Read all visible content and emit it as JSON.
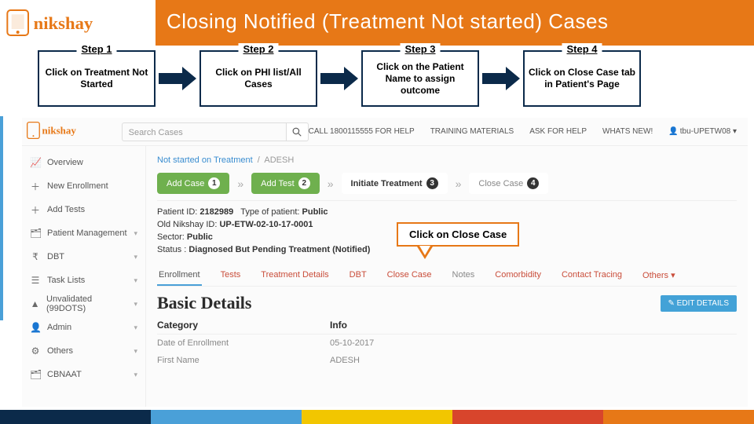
{
  "title": "Closing Notified (Treatment Not started) Cases",
  "steps": [
    {
      "label": "Step 1",
      "body": "Click on Treatment Not Started"
    },
    {
      "label": "Step 2",
      "body": "Click on PHI list/All Cases"
    },
    {
      "label": "Step 3",
      "body": "Click on the Patient Name to assign outcome"
    },
    {
      "label": "Step 4",
      "body": "Click on Close Case tab in Patient's Page"
    }
  ],
  "callout": "Click on Close Case",
  "app": {
    "search_placeholder": "Search Cases",
    "topnav": {
      "help": "CALL 1800115555 FOR HELP",
      "training": "TRAINING MATERIALS",
      "ask": "ASK FOR HELP",
      "new": "WHATS NEW!",
      "user": "tbu-UPETW08 ▾"
    },
    "sidebar": [
      {
        "icon": "📈",
        "label": "Overview",
        "caret": ""
      },
      {
        "icon": "＋",
        "label": "New Enrollment",
        "caret": ""
      },
      {
        "icon": "＋",
        "label": "Add Tests",
        "caret": ""
      },
      {
        "icon": "🗂",
        "label": "Patient Management",
        "caret": "▾"
      },
      {
        "icon": "₹",
        "label": "DBT",
        "caret": "▾"
      },
      {
        "icon": "☰",
        "label": "Task Lists",
        "caret": "▾"
      },
      {
        "icon": "▲",
        "label": "Unvalidated (99DOTS)",
        "caret": "▾"
      },
      {
        "icon": "👤",
        "label": "Admin",
        "caret": "▾"
      },
      {
        "icon": "⚙",
        "label": "Others",
        "caret": "▾"
      },
      {
        "icon": "🗂",
        "label": "CBNAAT",
        "caret": "▾"
      }
    ],
    "crumb_a": "Not started on Treatment",
    "crumb_b": "ADESH",
    "pills": {
      "add_case": "Add Case",
      "add_case_n": "1",
      "add_test": "Add Test",
      "add_test_n": "2",
      "initiate": "Initiate Treatment",
      "initiate_n": "3",
      "close": "Close Case",
      "close_n": "4"
    },
    "meta": {
      "pid_lbl": "Patient ID:",
      "pid": "2182989",
      "type_lbl": "Type of patient:",
      "type": "Public",
      "old_lbl": "Old Nikshay ID:",
      "old": "UP-ETW-02-10-17-0001",
      "sector_lbl": "Sector:",
      "sector": "Public",
      "status_lbl": "Status :",
      "status": "Diagnosed But Pending Treatment (Notified)"
    },
    "tabs": {
      "enroll": "Enrollment",
      "tests": "Tests",
      "treat": "Treatment Details",
      "dbt": "DBT",
      "close": "Close Case",
      "notes": "Notes",
      "comorb": "Comorbidity",
      "contact": "Contact Tracing",
      "others": "Others ▾"
    },
    "section": "Basic Details",
    "edit": "EDIT DETAILS",
    "cols": {
      "c1": "Category",
      "c2": "Info"
    },
    "rows": {
      "r1a": "Date of Enrollment",
      "r1b": "05-10-2017",
      "r2a": "First Name",
      "r2b": "ADESH"
    }
  }
}
